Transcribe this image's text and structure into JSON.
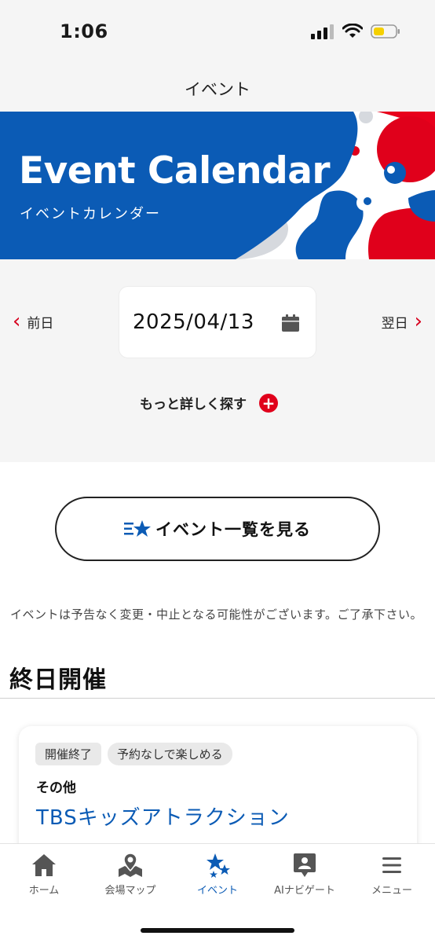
{
  "status_bar": {
    "time": "1:06"
  },
  "header": {
    "title": "イベント"
  },
  "banner": {
    "title": "Event Calendar",
    "subtitle": "イベントカレンダー"
  },
  "date_nav": {
    "prev_label": "前日",
    "next_label": "翌日",
    "date": "2025/04/13",
    "more_search": "もっと詳しく探す"
  },
  "list_button": {
    "label": "イベント一覧を見る"
  },
  "notice": "イベントは予告なく変更・中止となる可能性がございます。ご了承下さい。",
  "section": {
    "heading": "終日開催"
  },
  "event_card": {
    "tags": [
      "開催終了",
      "予約なしで楽しめる"
    ],
    "category": "その他",
    "title": "TBSキッズアトラクション"
  },
  "tab_bar": {
    "items": [
      {
        "label": "ホーム",
        "icon": "home-icon"
      },
      {
        "label": "会場マップ",
        "icon": "map-icon"
      },
      {
        "label": "イベント",
        "icon": "stars-icon",
        "active": true
      },
      {
        "label": "AIナビゲート",
        "icon": "ai-navigate-icon"
      },
      {
        "label": "メニュー",
        "icon": "menu-icon"
      }
    ]
  },
  "colors": {
    "brand_blue": "#0b5bb5",
    "accent_red": "#e0001b",
    "background_gray": "#f5f5f5"
  }
}
